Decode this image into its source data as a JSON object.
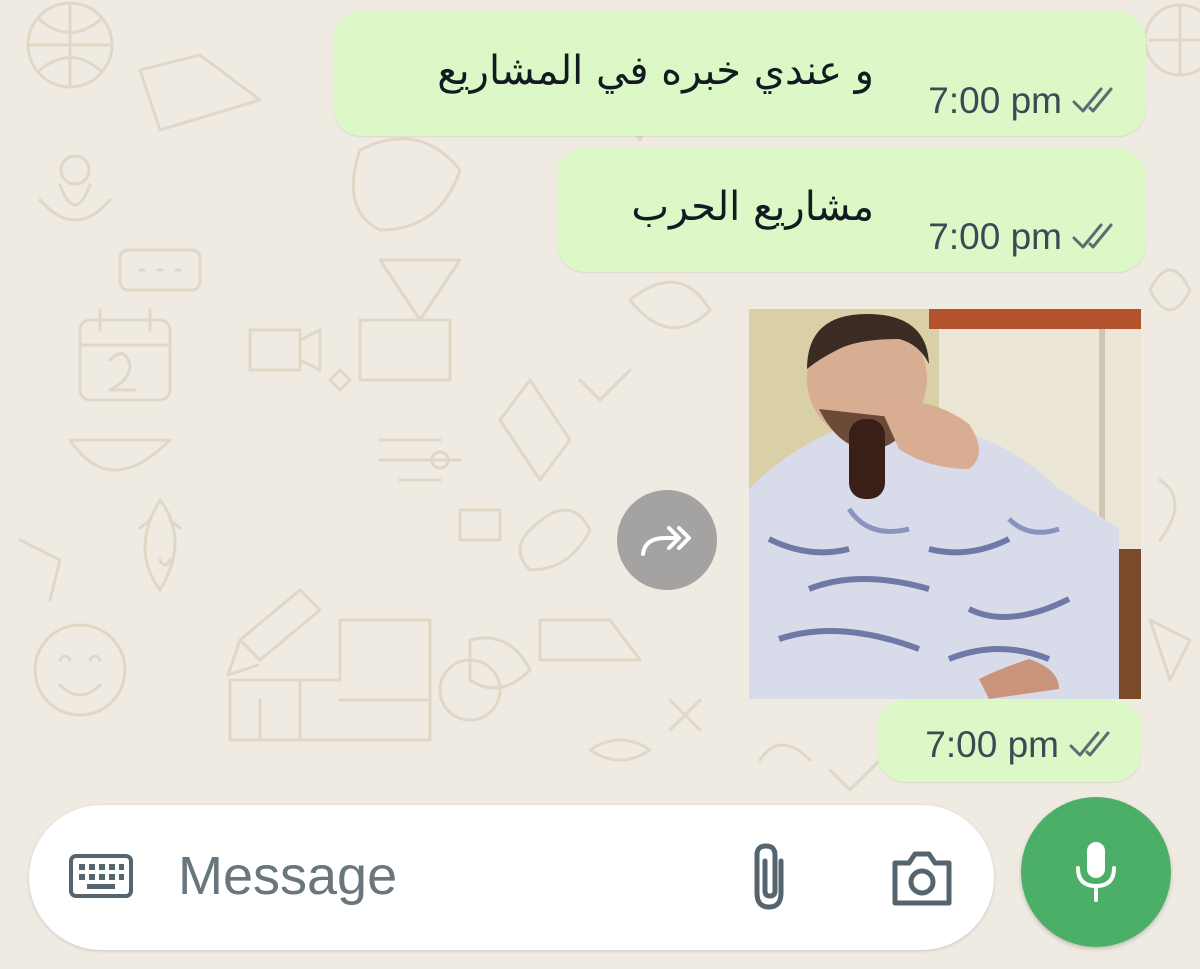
{
  "messages": [
    {
      "text": "و عندي خبره في المشاريع",
      "time": "7:00 pm",
      "status": "read"
    },
    {
      "text": "مشاريع الحرب",
      "time": "7:00 pm",
      "status": "read"
    },
    {
      "type": "media",
      "time": "7:00 pm",
      "status": "read"
    }
  ],
  "composer": {
    "placeholder": "Message",
    "icons": [
      "keyboard-icon",
      "attach-icon",
      "camera-icon"
    ]
  },
  "actions": {
    "forward_icon": "forward-icon",
    "mic_icon": "mic-icon"
  },
  "colors": {
    "background": "#efeae2",
    "outgoing_bubble": "#dcf8c6",
    "accent": "#4caf67"
  }
}
